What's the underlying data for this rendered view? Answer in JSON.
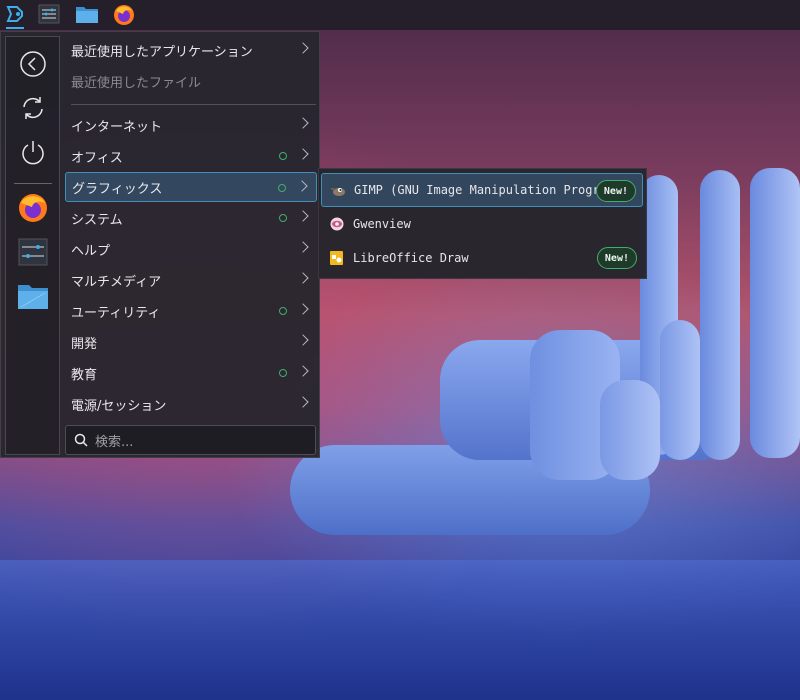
{
  "taskbar": {
    "icons": [
      "app-launcher-icon",
      "system-settings-icon",
      "file-manager-icon",
      "firefox-icon"
    ]
  },
  "sidebar": {
    "buttons": [
      "back-icon",
      "refresh-icon",
      "power-icon",
      "firefox-icon",
      "system-settings-icon",
      "file-manager-icon"
    ]
  },
  "menu": {
    "recent_apps": "最近使用したアプリケーション",
    "recent_files": "最近使用したファイル",
    "categories": [
      {
        "label": "インターネット",
        "new": false
      },
      {
        "label": "オフィス",
        "new": true
      },
      {
        "label": "グラフィックス",
        "new": true
      },
      {
        "label": "システム",
        "new": true
      },
      {
        "label": "ヘルプ",
        "new": false
      },
      {
        "label": "マルチメディア",
        "new": false
      },
      {
        "label": "ユーティリティ",
        "new": true
      },
      {
        "label": "開発",
        "new": false
      },
      {
        "label": "教育",
        "new": true
      },
      {
        "label": "電源/セッション",
        "new": false
      }
    ]
  },
  "search": {
    "placeholder": "検索..."
  },
  "submenu": {
    "items": [
      {
        "label": "GIMP (GNU Image Manipulation Program)",
        "badge": "New!"
      },
      {
        "label": "Gwenview",
        "badge": ""
      },
      {
        "label": "LibreOffice Draw",
        "badge": "New!"
      }
    ]
  },
  "colors": {
    "accent": "#3daee9",
    "new_dot": "#3fb06a"
  }
}
